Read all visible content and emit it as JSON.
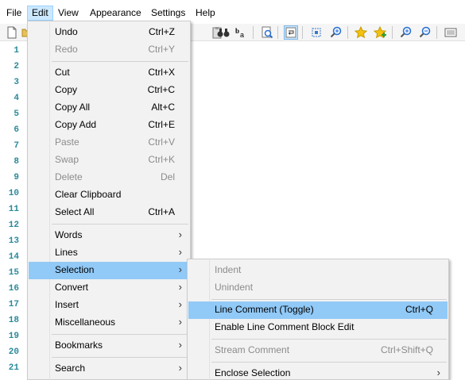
{
  "menubar": {
    "items": [
      {
        "label": "File"
      },
      {
        "label": "Edit"
      },
      {
        "label": "View"
      },
      {
        "label": "Appearance"
      },
      {
        "label": "Settings"
      },
      {
        "label": "Help"
      }
    ]
  },
  "toolbar": {
    "icons": [
      "new-file-icon",
      "open-folder-icon",
      "paste-icon",
      "find-binoculars-icon",
      "replace-icon",
      "find-in-files-icon",
      "word-wrap-icon",
      "expand-icon",
      "zoom-view-icon",
      "favorite-star-icon",
      "add-favorite-icon",
      "zoom-in-icon",
      "zoom-out-icon",
      "customize-toolbar-icon"
    ]
  },
  "editor": {
    "line_numbers": [
      "1",
      "2",
      "3",
      "4",
      "5",
      "6",
      "7",
      "8",
      "9",
      "10",
      "11",
      "12",
      "13",
      "14",
      "15",
      "16",
      "17",
      "18",
      "19",
      "20",
      "21"
    ]
  },
  "edit_menu": {
    "items": [
      {
        "label": "Undo",
        "shortcut": "Ctrl+Z",
        "disabled": false
      },
      {
        "label": "Redo",
        "shortcut": "Ctrl+Y",
        "disabled": true
      },
      {
        "label": "Cut",
        "shortcut": "Ctrl+X",
        "disabled": false
      },
      {
        "label": "Copy",
        "shortcut": "Ctrl+C",
        "disabled": false
      },
      {
        "label": "Copy All",
        "shortcut": "Alt+C",
        "disabled": false
      },
      {
        "label": "Copy Add",
        "shortcut": "Ctrl+E",
        "disabled": false
      },
      {
        "label": "Paste",
        "shortcut": "Ctrl+V",
        "disabled": true
      },
      {
        "label": "Swap",
        "shortcut": "Ctrl+K",
        "disabled": true
      },
      {
        "label": "Delete",
        "shortcut": "Del",
        "disabled": true
      },
      {
        "label": "Clear Clipboard",
        "shortcut": "",
        "disabled": false
      },
      {
        "label": "Select All",
        "shortcut": "Ctrl+A",
        "disabled": false
      },
      {
        "label": "Words",
        "submenu": true
      },
      {
        "label": "Lines",
        "submenu": true
      },
      {
        "label": "Selection",
        "submenu": true,
        "highlighted": true
      },
      {
        "label": "Convert",
        "submenu": true
      },
      {
        "label": "Insert",
        "submenu": true
      },
      {
        "label": "Miscellaneous",
        "submenu": true
      },
      {
        "label": "Bookmarks",
        "submenu": true
      },
      {
        "label": "Search",
        "submenu": true
      }
    ]
  },
  "selection_submenu": {
    "items": [
      {
        "label": "Indent",
        "shortcut": "",
        "disabled": true
      },
      {
        "label": "Unindent",
        "shortcut": "",
        "disabled": true
      },
      {
        "label": "Line Comment (Toggle)",
        "shortcut": "Ctrl+Q",
        "disabled": false,
        "highlighted": true
      },
      {
        "label": "Enable Line Comment Block Edit",
        "shortcut": "",
        "disabled": false
      },
      {
        "label": "Stream Comment",
        "shortcut": "Ctrl+Shift+Q",
        "disabled": true
      },
      {
        "label": "Enclose Selection",
        "submenu": true
      }
    ]
  },
  "colors": {
    "highlight": "#91c9f7",
    "menu_bg": "#f2f2f2",
    "line_number": "#2b8a9a",
    "disabled_text": "#8c8c8c"
  }
}
